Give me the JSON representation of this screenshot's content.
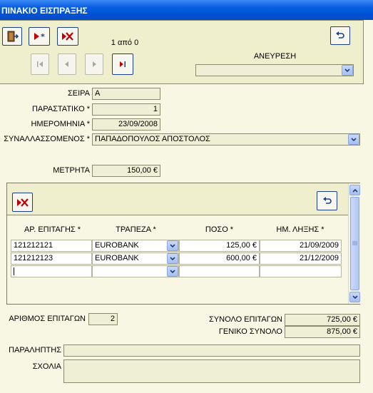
{
  "window": {
    "title": "ΠΙΝΑΚΙΟ ΕΙΣΠΡΑΞΗΣ"
  },
  "toolbar": {
    "record_counter": "1 από 0",
    "search_label": "ΑΝΕΥΡΕΣΗ",
    "search_value": ""
  },
  "form": {
    "series_label": "ΣΕΙΡΑ",
    "series_value": "Α",
    "document_label": "ΠΑΡΑΣΤΑΤΙΚΟ *",
    "document_value": "1",
    "date_label": "ΗΜΕΡΟΜΗΝΙΑ *",
    "date_value": "23/09/2008",
    "customer_label": "ΣΥΝΑΛΛΑΣΣΟΜΕΝΟΣ *",
    "customer_value": "ΠΑΠΑΔΟΠΟΥΛΟΣ ΑΠΟΣΤΟΛΟΣ",
    "cash_label": "ΜΕΤΡΗΤΑ",
    "cash_value": "150,00 €"
  },
  "checks": {
    "headers": [
      "ΑΡ. ΕΠΙΤΑΓΗΣ *",
      "ΤΡΑΠΕΖΑ *",
      "ΠΟΣΟ *",
      "ΗΜ. ΛΗΞΗΣ *"
    ],
    "rows": [
      {
        "number": "121212121",
        "bank": "EUROBANK",
        "amount": "125,00 €",
        "due": "21/09/2009"
      },
      {
        "number": "121212123",
        "bank": "EUROBANK",
        "amount": "600,00 €",
        "due": "21/12/2009"
      }
    ]
  },
  "totals": {
    "checks_count_label": "ΑΡΙΘΜΟΣ ΕΠΙΤΑΓΩΝ",
    "checks_count_value": "2",
    "checks_sum_label": "ΣΥΝΟΛΟ ΕΠΙΤΑΓΩΝ",
    "checks_sum_value": "725,00 €",
    "grand_total_label": "ΓΕΝΙΚΟ ΣΥΝΟΛΟ",
    "grand_total_value": "875,00 €"
  },
  "footer": {
    "receiver_label": "ΠΑΡΑΛΗΠΤΗΣ",
    "receiver_value": "",
    "notes_label": "ΣΧΟΛΙΑ",
    "notes_value": ""
  },
  "colors": {
    "title_bar": "#0a5fe0",
    "form_background": "#f7f7e3",
    "field_background": "#efefd6",
    "button_red": "#c00000",
    "button_blue": "#1c3f8a"
  }
}
